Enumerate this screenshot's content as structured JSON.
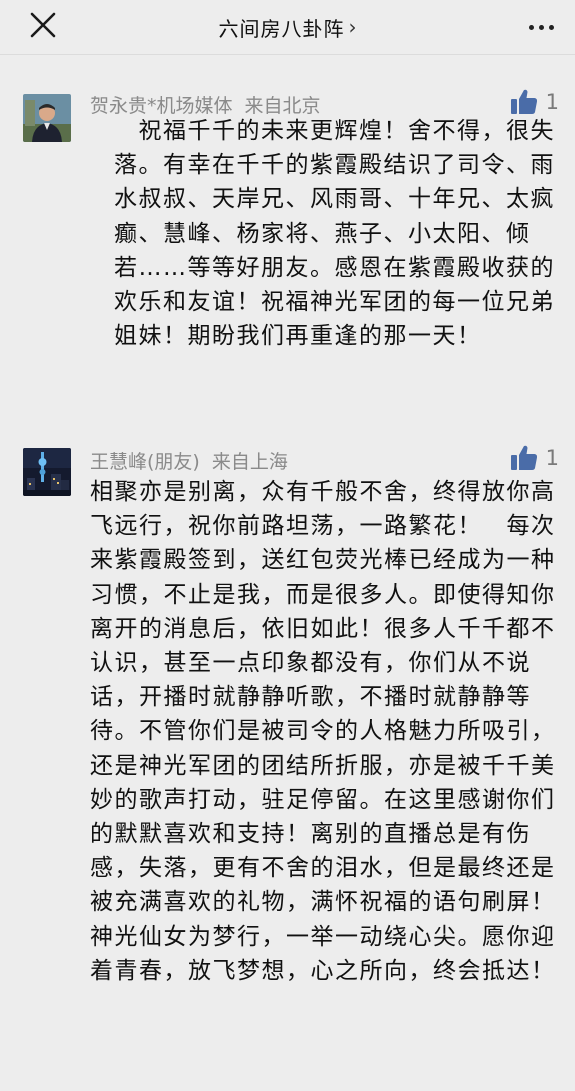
{
  "header": {
    "title": "六间房八卦阵",
    "chevron": "›",
    "close_icon": "close-icon",
    "more_icon": "more-dots-icon"
  },
  "comments": [
    {
      "author": "贺永贵*机场媒体",
      "location": "来自北京",
      "likes": "1",
      "avatar_icon": "user-photo-man-icon",
      "text": "　祝福千千的未来更辉煌！舍不得，很失落。有幸在千千的紫霞殿结识了司令、雨水叔叔、天岸兄、风雨哥、十年兄、太疯癫、慧峰、杨家将、燕子、小太阳、倾若……等等好朋友。感恩在紫霞殿收获的欢乐和友谊！祝福神光军团的每一位兄弟姐妹！期盼我们再重逢的那一天！"
    },
    {
      "author": "王慧峰(朋友)",
      "location": "来自上海",
      "likes": "1",
      "avatar_icon": "city-night-tower-icon",
      "text": "相聚亦是别离，众有千般不舍，终得放你高飞远行，祝你前路坦荡，一路繁花！　每次来紫霞殿签到，送红包荧光棒已经成为一种习惯，不止是我，而是很多人。即使得知你离开的消息后，依旧如此！很多人千千都不认识，甚至一点印象都没有，你们从不说话，开播时就静静听歌，不播时就静静等待。不管你们是被司令的人格魅力所吸引，还是神光军团的团结所折服，亦是被千千美妙的歌声打动，驻足停留。在这里感谢你们的默默喜欢和支持！离别的直播总是有伤感，失落，更有不舍的泪水，但是最终还是被充满喜欢的礼物，满怀祝福的语句刷屏！　神光仙女为梦行，一举一动绕心尖。愿你迎着青春，放飞梦想，心之所向，终会抵达！"
    }
  ],
  "colors": {
    "background": "#ededed",
    "text": "#111111",
    "meta": "#8a8a8a",
    "like_icon": "#4a6ca8"
  }
}
